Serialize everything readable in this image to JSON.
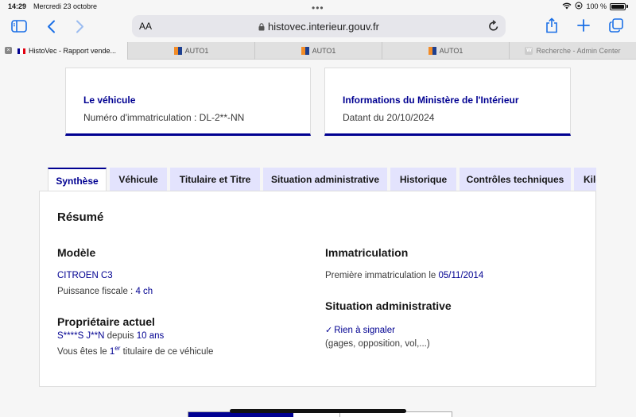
{
  "status": {
    "time": "14:29",
    "date": "Mercredi 23 octobre",
    "battery": "100 %"
  },
  "browser": {
    "url_aa": "AA",
    "url": "histovec.interieur.gouv.fr",
    "tabs": [
      {
        "label": "HistoVec - Rapport vende..."
      },
      {
        "label": "AUTO1"
      },
      {
        "label": "AUTO1"
      },
      {
        "label": "AUTO1"
      },
      {
        "label": "Recherche - Admin Center"
      }
    ]
  },
  "cards": {
    "vehicle": {
      "title": "Le véhicule",
      "text": "Numéro d'immatriculation : DL-2**-NN"
    },
    "ministry": {
      "title": "Informations du Ministère de l'Intérieur",
      "text": "Datant du 20/10/2024"
    }
  },
  "tabs": [
    "Synthèse",
    "Véhicule",
    "Titulaire et Titre",
    "Situation administrative",
    "Historique",
    "Contrôles techniques",
    "Kilométrage"
  ],
  "summary": {
    "title": "Résumé",
    "modele": {
      "heading": "Modèle",
      "name": "CITROEN C3",
      "fiscal_label": "Puissance fiscale : ",
      "fiscal_value": "4 ch"
    },
    "owner": {
      "heading": "Propriétaire actuel",
      "name": "S****S J**N",
      "since_label": " depuis ",
      "since_value": "10 ans",
      "rank_prefix": "Vous êtes le ",
      "rank_num": "1",
      "rank_sup": "er",
      "rank_suffix": " titulaire de ce véhicule"
    },
    "immat": {
      "heading": "Immatriculation",
      "label": "Première immatriculation le ",
      "date": "05/11/2014"
    },
    "situation": {
      "heading": "Situation administrative",
      "status": "Rien à signaler",
      "detail": "(gages, opposition, vol,...)"
    }
  }
}
